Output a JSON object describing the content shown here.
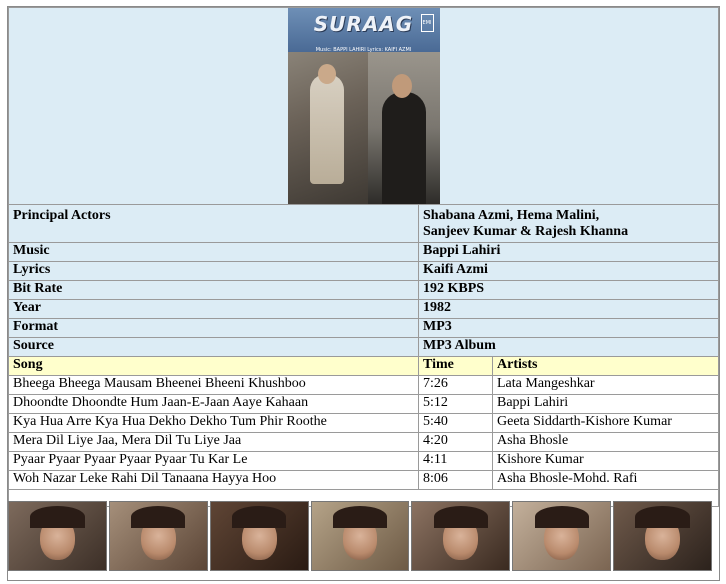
{
  "cover": {
    "title": "SURAAG",
    "credits": "Music: BAPPI LAHIRI   Lyrics: KAIFI AZMI",
    "badge": "EMI"
  },
  "info": [
    {
      "label": "Principal Actors",
      "value": "Shabana Azmi, Hema Malini,",
      "value2": "Sanjeev Kumar & Rajesh Khanna"
    },
    {
      "label": "Music",
      "value": "Bappi Lahiri"
    },
    {
      "label": "Lyrics",
      "value": "Kaifi Azmi"
    },
    {
      "label": "Bit Rate",
      "value": "192 KBPS"
    },
    {
      "label": "Year",
      "value": "1982"
    },
    {
      "label": "Format",
      "value": "MP3"
    },
    {
      "label": "Source",
      "value": "MP3 Album"
    }
  ],
  "songs_header": {
    "song": "Song",
    "time": "Time",
    "artists": "Artists"
  },
  "songs": [
    {
      "song": "Bheega Bheega Mausam Bheenei Bheeni Khushboo",
      "time": "7:26",
      "artists": "Lata Mangeshkar"
    },
    {
      "song": "Dhoondte Dhoondte Hum Jaan-E-Jaan Aaye Kahaan",
      "time": "5:12",
      "artists": "Bappi Lahiri"
    },
    {
      "song": "Kya Hua Arre Kya Hua Dekho Dekho Tum Phir Roothe",
      "time": "5:40",
      "artists": "Geeta Siddarth-Kishore Kumar"
    },
    {
      "song": "Mera Dil Liye Jaa, Mera Dil Tu Liye Jaa",
      "time": "4:20",
      "artists": "Asha Bhosle"
    },
    {
      "song": "Pyaar Pyaar Pyaar Pyaar Pyaar Tu Kar Le",
      "time": "4:11",
      "artists": "Kishore Kumar"
    },
    {
      "song": "Woh Nazar Leke Rahi Dil Tanaana Hayya Hoo",
      "time": "8:06",
      "artists": "Asha Bhosle-Mohd. Rafi"
    }
  ]
}
